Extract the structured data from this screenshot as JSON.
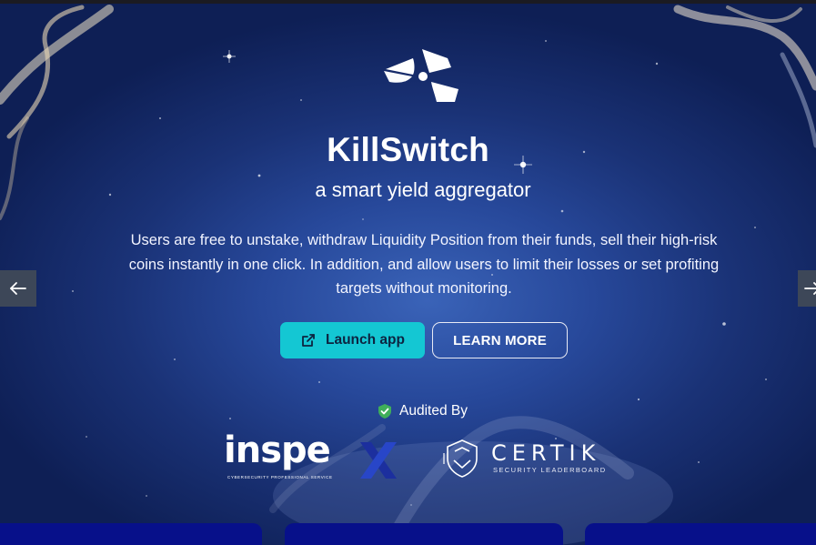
{
  "hero": {
    "title": "KillSwitch",
    "subtitle": "a smart yield aggregator",
    "description": "Users are free to unstake, withdraw Liquidity Position from their funds, sell their high-risk coins instantly in one click. In addition, and allow users to limit their losses or set profiting targets without monitoring."
  },
  "buttons": {
    "launch_label": "Launch app",
    "learn_more_label": "LEARN MORE"
  },
  "audit": {
    "label": "Audited By",
    "partners": {
      "inspex": {
        "name": "inspe",
        "tagline": "CYBERSECURITY PROFESSIONAL SERVICE"
      },
      "certik": {
        "name": "CERTIK",
        "tagline": "SECURITY LEADERBOARD"
      }
    }
  },
  "icons": {
    "logo": "killswitch-logo-icon",
    "launch": "external-link-icon",
    "audited": "shield-check-icon",
    "prev": "arrow-left-icon",
    "next": "arrow-right-icon"
  },
  "colors": {
    "accent": "#14c7d3",
    "background_dark": "#0e1f55",
    "background_light": "#3a63b8",
    "card": "#07108a",
    "audit_check": "#3fae5a"
  }
}
